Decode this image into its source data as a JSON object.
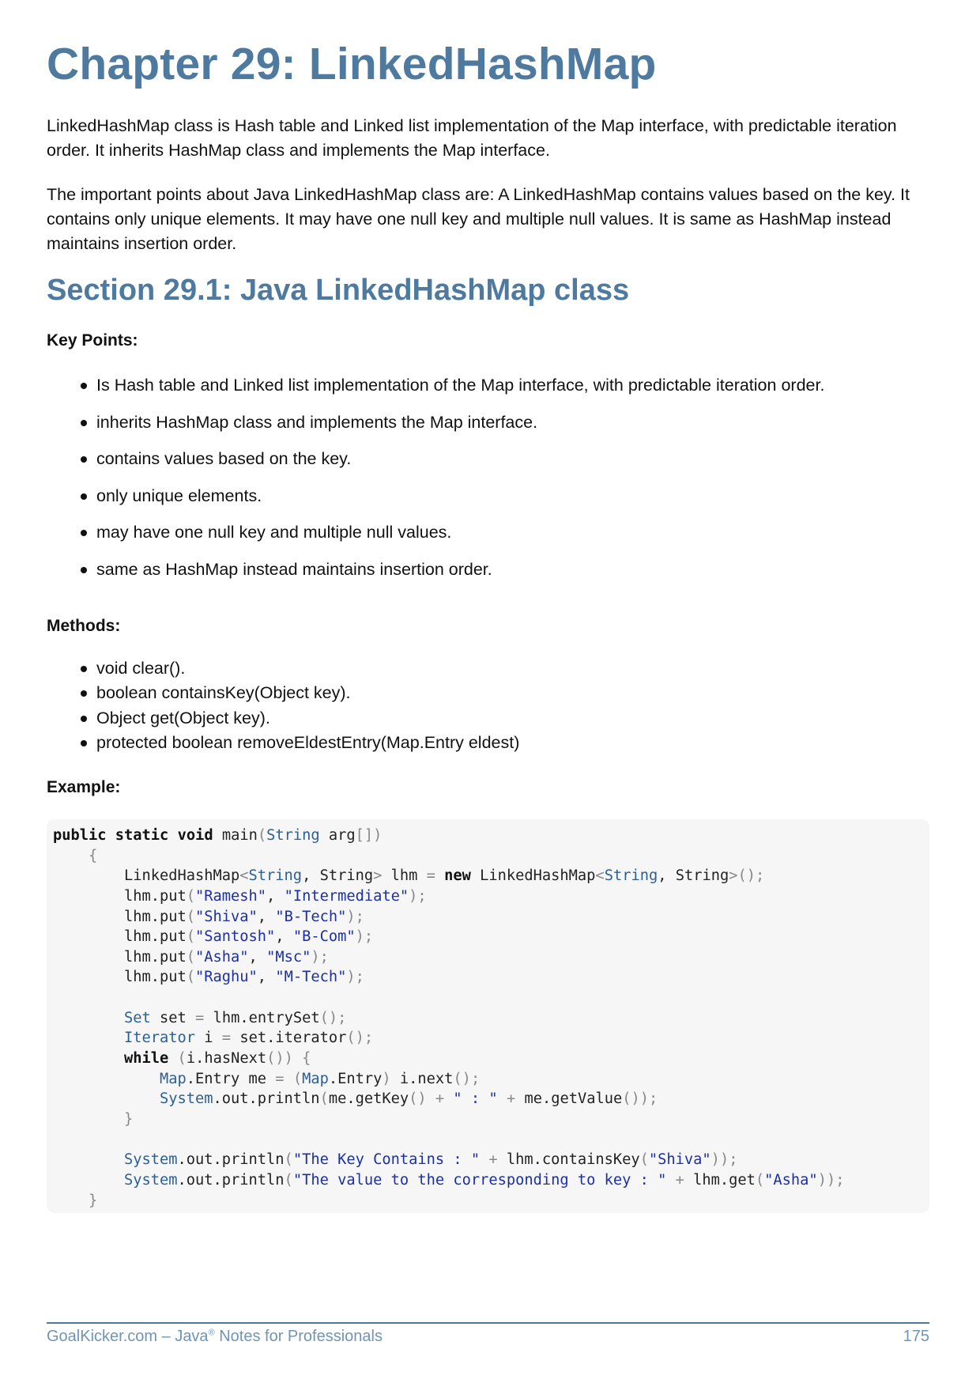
{
  "chapter_title": "Chapter 29: LinkedHashMap",
  "intro_paragraphs": [
    "LinkedHashMap class is Hash table and Linked list implementation of the Map interface, with predictable iteration order. It inherits HashMap class and implements the Map interface.",
    "The important points about Java LinkedHashMap class are: A LinkedHashMap contains values based on the key. It contains only unique elements. It may have one null key and multiple null values. It is same as HashMap instead maintains insertion order."
  ],
  "section_title": "Section 29.1: Java LinkedHashMap class",
  "key_points": {
    "label": "Key Points:",
    "items": [
      "Is Hash table and Linked list implementation of the Map interface, with predictable iteration order.",
      "inherits HashMap class and implements the Map interface.",
      "contains values based on the key.",
      "only unique elements.",
      "may have one null key and multiple null values.",
      "same as HashMap instead maintains insertion order."
    ]
  },
  "methods": {
    "label": "Methods:",
    "items": [
      "void clear().",
      "boolean containsKey(Object key).",
      "Object get(Object key).",
      "protected boolean removeEldestEntry(Map.Entry eldest)"
    ]
  },
  "example": {
    "label": "Example:",
    "code_lines": [
      "public static void main(String arg[])",
      "    {",
      "        LinkedHashMap<String, String> lhm = new LinkedHashMap<String, String>();",
      "        lhm.put(\"Ramesh\", \"Intermediate\");",
      "        lhm.put(\"Shiva\", \"B-Tech\");",
      "        lhm.put(\"Santosh\", \"B-Com\");",
      "        lhm.put(\"Asha\", \"Msc\");",
      "        lhm.put(\"Raghu\", \"M-Tech\");",
      "",
      "        Set set = lhm.entrySet();",
      "        Iterator i = set.iterator();",
      "        while (i.hasNext()) {",
      "            Map.Entry me = (Map.Entry) i.next();",
      "            System.out.println(me.getKey() + \" : \" + me.getValue());",
      "        }",
      "",
      "        System.out.println(\"The Key Contains : \" + lhm.containsKey(\"Shiva\"));",
      "        System.out.println(\"The value to the corresponding to key : \" + lhm.get(\"Asha\"));",
      "    }"
    ]
  },
  "footer": {
    "site": "GoalKicker.com",
    "separator": " – ",
    "book_prefix": "Java",
    "registered_mark": "®",
    "book_suffix": " Notes for Professionals",
    "page_number": "175"
  },
  "colors": {
    "heading": "#4e7aa0",
    "footer_text": "#6f95b6",
    "code_background": "#f6f6f6",
    "code_type": "#2b5f96",
    "code_string": "#1c2fa6"
  }
}
